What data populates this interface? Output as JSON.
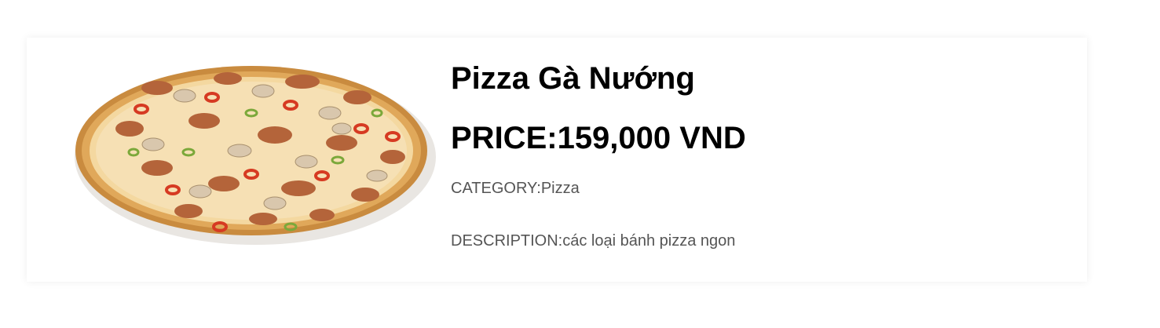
{
  "product": {
    "name": "Pizza Gà Nướng",
    "price_label": "PRICE:159,000 VND",
    "category_label": "CATEGORY:Pizza",
    "description_label": "DESCRIPTION:các loại bánh pizza ngon",
    "image_icon": "pizza-image"
  },
  "colors": {
    "background": "#ffffff",
    "text_primary": "#000000",
    "text_secondary": "#555555"
  }
}
